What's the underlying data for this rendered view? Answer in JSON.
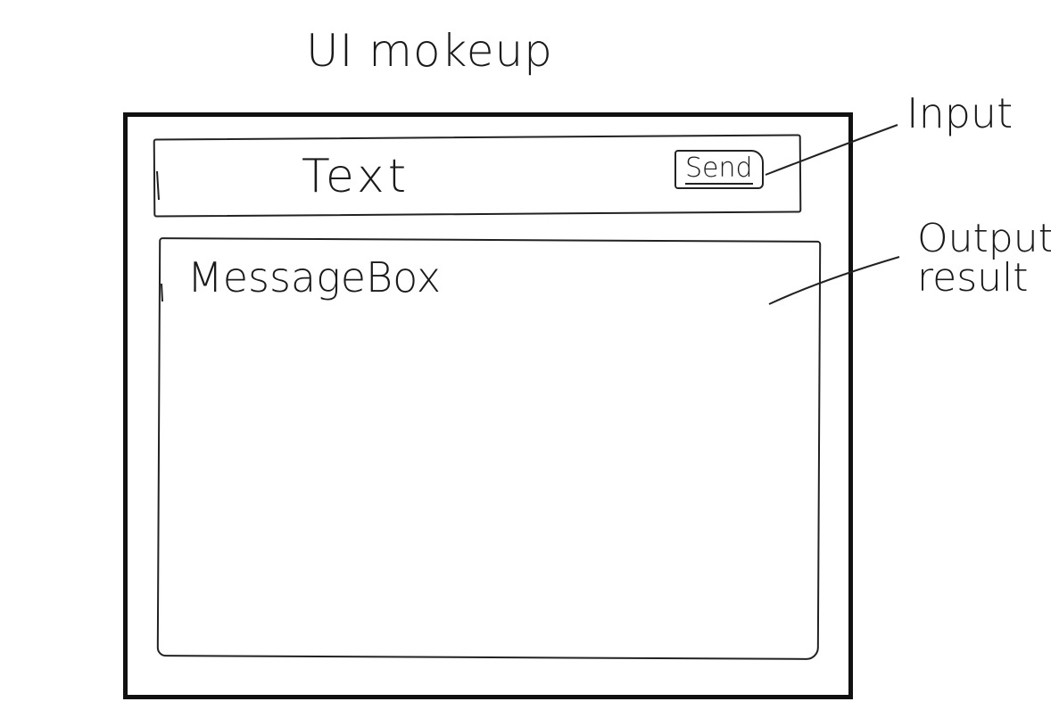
{
  "title": "UI mokeup",
  "input_area": {
    "placeholder_text": "Text",
    "send_label": "Send"
  },
  "output_area": {
    "label": "MessageBox"
  },
  "annotations": {
    "input": "Input",
    "output_line1": "Output",
    "output_line2": "result"
  }
}
